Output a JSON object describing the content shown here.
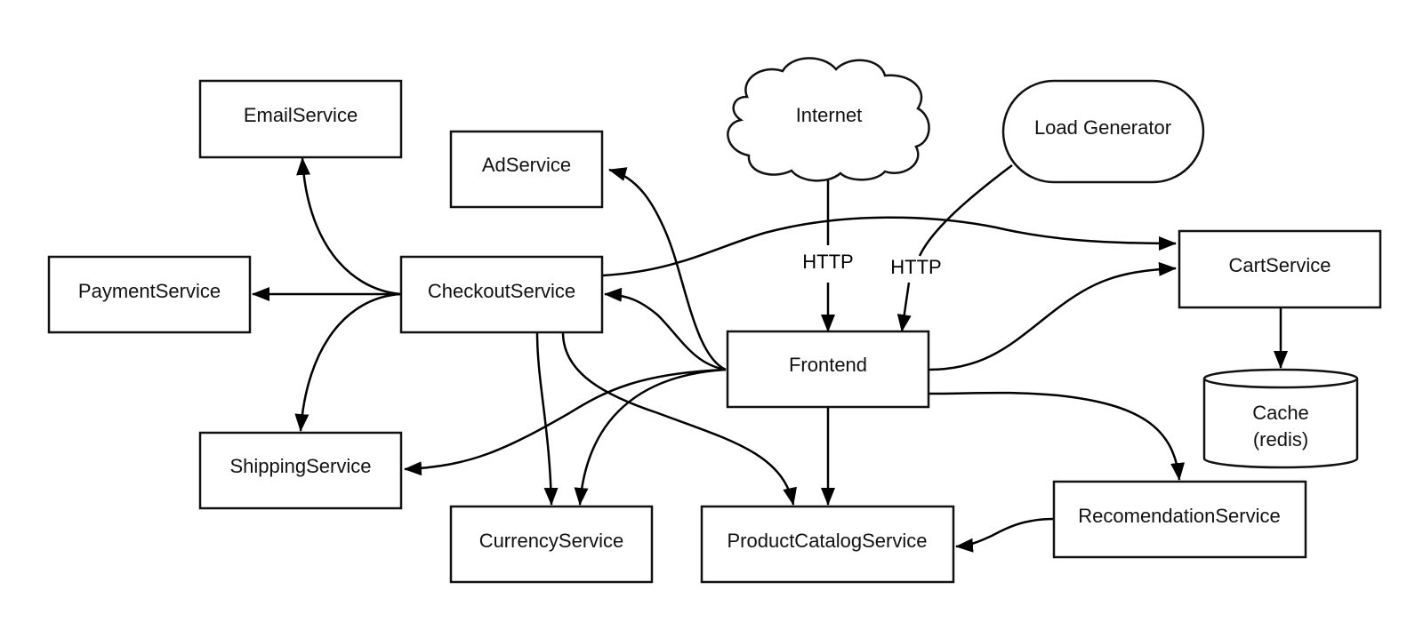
{
  "diagram": {
    "type": "microservices-architecture",
    "colors": {
      "stroke": "#111111",
      "background": "#ffffff",
      "text": "#111111"
    },
    "nodes": {
      "email": {
        "label": "EmailService",
        "shape": "rectangle"
      },
      "ad": {
        "label": "AdService",
        "shape": "rectangle"
      },
      "internet": {
        "label": "Internet",
        "shape": "cloud"
      },
      "loadgen": {
        "label": "Load Generator",
        "shape": "stadium"
      },
      "payment": {
        "label": "PaymentService",
        "shape": "rectangle"
      },
      "checkout": {
        "label": "CheckoutService",
        "shape": "rectangle"
      },
      "cart": {
        "label": "CartService",
        "shape": "rectangle"
      },
      "frontend": {
        "label": "Frontend",
        "shape": "rectangle"
      },
      "cache": {
        "label_line1": "Cache",
        "label_line2": "(redis)",
        "shape": "cylinder"
      },
      "shipping": {
        "label": "ShippingService",
        "shape": "rectangle"
      },
      "currency": {
        "label": "CurrencyService",
        "shape": "rectangle"
      },
      "productcatalog": {
        "label": "ProductCatalogService",
        "shape": "rectangle"
      },
      "recommendation": {
        "label": "RecomendationService",
        "shape": "rectangle"
      }
    },
    "edges": [
      {
        "from": "Internet",
        "to": "Frontend",
        "label": "HTTP"
      },
      {
        "from": "Load Generator",
        "to": "Frontend",
        "label": "HTTP"
      },
      {
        "from": "Frontend",
        "to": "AdService",
        "label": ""
      },
      {
        "from": "Frontend",
        "to": "CheckoutService",
        "label": ""
      },
      {
        "from": "Frontend",
        "to": "ShippingService",
        "label": ""
      },
      {
        "from": "Frontend",
        "to": "CurrencyService",
        "label": ""
      },
      {
        "from": "Frontend",
        "to": "ProductCatalogService",
        "label": ""
      },
      {
        "from": "Frontend",
        "to": "CartService",
        "label": ""
      },
      {
        "from": "Frontend",
        "to": "RecomendationService",
        "label": ""
      },
      {
        "from": "CheckoutService",
        "to": "EmailService",
        "label": ""
      },
      {
        "from": "CheckoutService",
        "to": "PaymentService",
        "label": ""
      },
      {
        "from": "CheckoutService",
        "to": "ShippingService",
        "label": ""
      },
      {
        "from": "CheckoutService",
        "to": "CurrencyService",
        "label": ""
      },
      {
        "from": "CheckoutService",
        "to": "ProductCatalogService",
        "label": ""
      },
      {
        "from": "CheckoutService",
        "to": "CartService",
        "label": ""
      },
      {
        "from": "CartService",
        "to": "Cache (redis)",
        "label": ""
      },
      {
        "from": "RecomendationService",
        "to": "ProductCatalogService",
        "label": ""
      }
    ],
    "edge_labels": {
      "internet_http": "HTTP",
      "loadgen_http": "HTTP"
    }
  }
}
